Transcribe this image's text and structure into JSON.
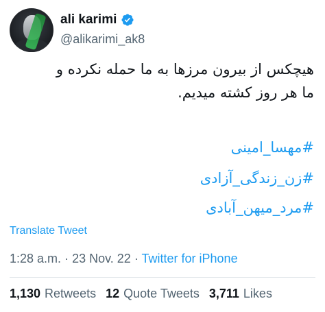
{
  "author": {
    "name": "ali karimi",
    "handle": "@alikarimi_ak8",
    "verified": true
  },
  "tweet": {
    "text_line1": "هیچکس از بیرون مرزها به ما حمله نکرده و",
    "text_line2": "ما هر روز کشته میدیم.",
    "hashtags": [
      "#مهسا_امینی",
      "#زن_زندگی_آزادی",
      "#مرد_میهن_آبادی"
    ],
    "translate_label": "Translate Tweet"
  },
  "meta": {
    "time": "1:28 a.m.",
    "separator": "·",
    "date": "23 Nov. 22",
    "source": "Twitter for iPhone"
  },
  "stats": {
    "retweets_count": "1,130",
    "retweets_label": "Retweets",
    "quotes_count": "12",
    "quotes_label": "Quote Tweets",
    "likes_count": "3,711",
    "likes_label": "Likes"
  },
  "colors": {
    "link": "#1d9bf0",
    "secondary": "#536471",
    "primary": "#0f1419"
  }
}
